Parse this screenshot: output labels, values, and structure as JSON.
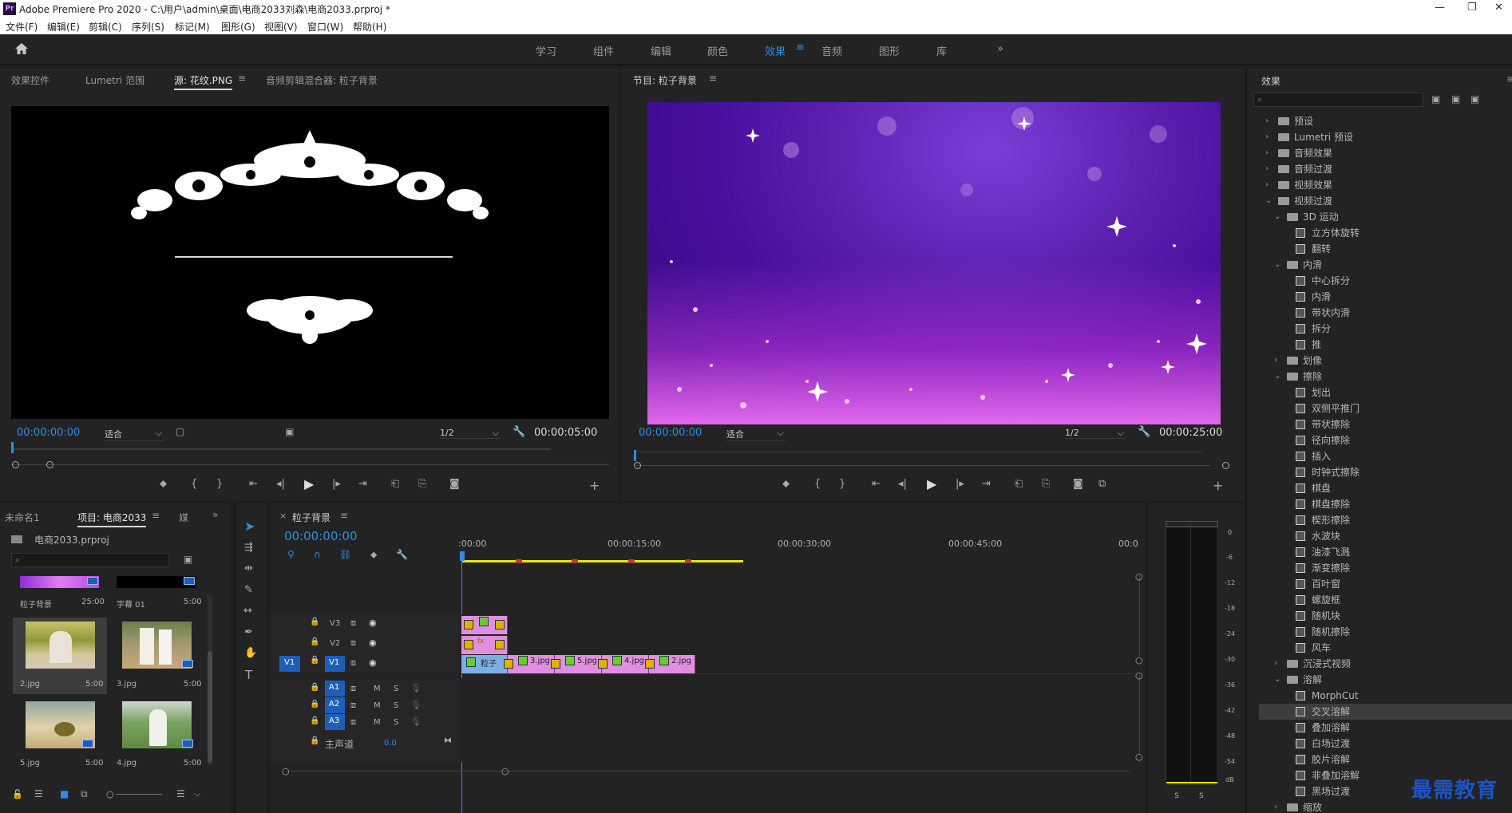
{
  "window": {
    "title": "Adobe Premiere Pro 2020 - C:\\用户\\admin\\桌面\\电商2033刘森\\电商2033.prproj *",
    "logo": "Pr"
  },
  "menu": [
    "文件(F)",
    "编辑(E)",
    "剪辑(C)",
    "序列(S)",
    "标记(M)",
    "图形(G)",
    "视图(V)",
    "窗口(W)",
    "帮助(H)"
  ],
  "workspaces": {
    "items": [
      "学习",
      "组件",
      "编辑",
      "颜色",
      "效果",
      "音频",
      "图形",
      "库"
    ],
    "active": "效果",
    "more": "»"
  },
  "source_panel": {
    "tabs": [
      "效果控件",
      "Lumetri 范围",
      "源: 花纹.PNG",
      "音频剪辑混合器: 粒子背景"
    ],
    "active_tab": "源: 花纹.PNG",
    "timecode": "00:00:00:00",
    "fit": "适合",
    "resolution": "1/2",
    "duration": "00:00:05:00"
  },
  "program_panel": {
    "tab": "节目: 粒子背景",
    "timecode": "00:00:00:00",
    "fit": "适合",
    "resolution": "1/2",
    "duration": "00:00:25:00"
  },
  "project_panel": {
    "tabs": [
      "未命名1",
      "项目: 电商2033",
      "媒"
    ],
    "active_tab": "项目: 电商2033",
    "file": "电商2033.prproj",
    "search_placeholder": "",
    "items": [
      {
        "name": "粒子背景",
        "duration": "25:00"
      },
      {
        "name": "字幕 01",
        "duration": "5:00"
      },
      {
        "name": "2.jpg",
        "duration": "5:00"
      },
      {
        "name": "3.jpg",
        "duration": "5:00"
      },
      {
        "name": "5.jpg",
        "duration": "5:00"
      },
      {
        "name": "4.jpg",
        "duration": "5:00"
      }
    ]
  },
  "timeline": {
    "tab": "粒子背景",
    "timecode": "00:00:00:00",
    "ruler": [
      ":00:00",
      "00:00:15:00",
      "00:00:30:00",
      "00:00:45:00",
      "00:0"
    ],
    "video_tracks": [
      "V3",
      "V2",
      "V1"
    ],
    "source_patch": "V1",
    "audio_tracks": [
      "A1",
      "A2",
      "A3"
    ],
    "mute": "M",
    "solo": "S",
    "master": {
      "label": "主声道",
      "value": "0.0"
    },
    "v1_clips": [
      "粒子",
      "3.jpg",
      "5.jpg",
      "4.jpg",
      "2.jpg"
    ],
    "v2_clip": "fx"
  },
  "audio_meter": {
    "ticks": [
      "0",
      "-6",
      "-12",
      "-18",
      "-24",
      "-30",
      "-36",
      "-42",
      "-48",
      "-54",
      "dB"
    ],
    "solo": [
      "S",
      "S"
    ]
  },
  "effects_panel": {
    "title": "效果",
    "tree": [
      {
        "label": "预设",
        "depth": 0,
        "type": "folder",
        "state": "closed"
      },
      {
        "label": "Lumetri 预设",
        "depth": 0,
        "type": "folder",
        "state": "closed"
      },
      {
        "label": "音频效果",
        "depth": 0,
        "type": "folder",
        "state": "closed"
      },
      {
        "label": "音频过渡",
        "depth": 0,
        "type": "folder",
        "state": "closed"
      },
      {
        "label": "视频效果",
        "depth": 0,
        "type": "folder",
        "state": "closed"
      },
      {
        "label": "视频过渡",
        "depth": 0,
        "type": "folder",
        "state": "open"
      },
      {
        "label": "3D 运动",
        "depth": 1,
        "type": "folder",
        "state": "open"
      },
      {
        "label": "立方体旋转",
        "depth": 2,
        "type": "item"
      },
      {
        "label": "翻转",
        "depth": 2,
        "type": "item"
      },
      {
        "label": "内滑",
        "depth": 1,
        "type": "folder",
        "state": "open"
      },
      {
        "label": "中心拆分",
        "depth": 2,
        "type": "item"
      },
      {
        "label": "内滑",
        "depth": 2,
        "type": "item"
      },
      {
        "label": "带状内滑",
        "depth": 2,
        "type": "item"
      },
      {
        "label": "拆分",
        "depth": 2,
        "type": "item"
      },
      {
        "label": "推",
        "depth": 2,
        "type": "item"
      },
      {
        "label": "划像",
        "depth": 1,
        "type": "folder",
        "state": "closed"
      },
      {
        "label": "擦除",
        "depth": 1,
        "type": "folder",
        "state": "open"
      },
      {
        "label": "划出",
        "depth": 2,
        "type": "item"
      },
      {
        "label": "双侧平推门",
        "depth": 2,
        "type": "item"
      },
      {
        "label": "带状擦除",
        "depth": 2,
        "type": "item"
      },
      {
        "label": "径向擦除",
        "depth": 2,
        "type": "item"
      },
      {
        "label": "插入",
        "depth": 2,
        "type": "item"
      },
      {
        "label": "时钟式擦除",
        "depth": 2,
        "type": "item"
      },
      {
        "label": "棋盘",
        "depth": 2,
        "type": "item"
      },
      {
        "label": "棋盘擦除",
        "depth": 2,
        "type": "item"
      },
      {
        "label": "楔形擦除",
        "depth": 2,
        "type": "item"
      },
      {
        "label": "水波块",
        "depth": 2,
        "type": "item"
      },
      {
        "label": "油漆飞溅",
        "depth": 2,
        "type": "item"
      },
      {
        "label": "渐变擦除",
        "depth": 2,
        "type": "item"
      },
      {
        "label": "百叶窗",
        "depth": 2,
        "type": "item"
      },
      {
        "label": "螺旋框",
        "depth": 2,
        "type": "item"
      },
      {
        "label": "随机块",
        "depth": 2,
        "type": "item"
      },
      {
        "label": "随机擦除",
        "depth": 2,
        "type": "item"
      },
      {
        "label": "风车",
        "depth": 2,
        "type": "item"
      },
      {
        "label": "沉浸式视频",
        "depth": 1,
        "type": "folder",
        "state": "closed"
      },
      {
        "label": "溶解",
        "depth": 1,
        "type": "folder",
        "state": "open"
      },
      {
        "label": "MorphCut",
        "depth": 2,
        "type": "item"
      },
      {
        "label": "交叉溶解",
        "depth": 2,
        "type": "item",
        "selected": true
      },
      {
        "label": "叠加溶解",
        "depth": 2,
        "type": "item"
      },
      {
        "label": "白场过渡",
        "depth": 2,
        "type": "item"
      },
      {
        "label": "胶片溶解",
        "depth": 2,
        "type": "item"
      },
      {
        "label": "非叠加溶解",
        "depth": 2,
        "type": "item"
      },
      {
        "label": "黑场过渡",
        "depth": 2,
        "type": "item"
      },
      {
        "label": "缩放",
        "depth": 1,
        "type": "folder",
        "state": "closed"
      }
    ]
  },
  "watermark": "最需教育",
  "colors": {
    "accent": "#2d8ceb",
    "clip_pink": "#e08fe0",
    "clip_blue": "#7bb0e6",
    "work_area": "#e8e800"
  }
}
